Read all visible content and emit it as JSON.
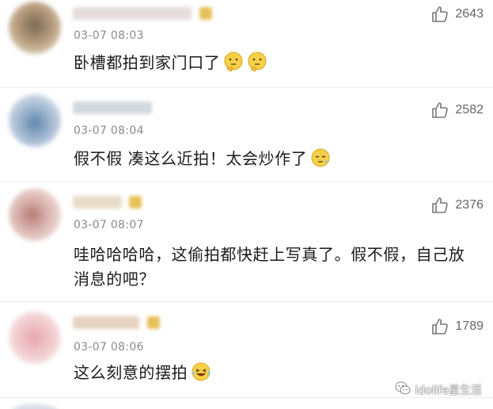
{
  "comments": [
    {
      "time": "03-07 08:03",
      "text": "卧槽都拍到家门口了",
      "likes": "2643",
      "emojis": [
        "thinking-emoji",
        "thinking-emoji"
      ],
      "avatar_color": "#b59a7a",
      "name_color": "#e3d8d8",
      "badge_color": "#e6c15a"
    },
    {
      "time": "03-07 08:04",
      "text": "假不假  凑这么近拍！太会炒作了",
      "likes": "2582",
      "emojis": [
        "sleepy-sweat-emoji"
      ],
      "avatar_color": "#9fb6cf",
      "name_color": "#d8dde3",
      "badge_color": ""
    },
    {
      "time": "03-07 08:07",
      "text": "哇哈哈哈哈，这偷拍都快赶上写真了。假不假，自己放消息的吧？",
      "likes": "2376",
      "emojis": [],
      "avatar_color": "#d9b3ae",
      "name_color": "#e9dccb",
      "badge_color": "#e6c15a"
    },
    {
      "time": "03-07 08:06",
      "text": "这么刻意的摆拍",
      "likes": "1789",
      "emojis": [
        "laughing-tears-emoji"
      ],
      "avatar_color": "#f0c9cc",
      "name_color": "#ead8c8",
      "badge_color": "#e6c15a"
    }
  ],
  "watermark": {
    "text": "idolife星生活"
  }
}
